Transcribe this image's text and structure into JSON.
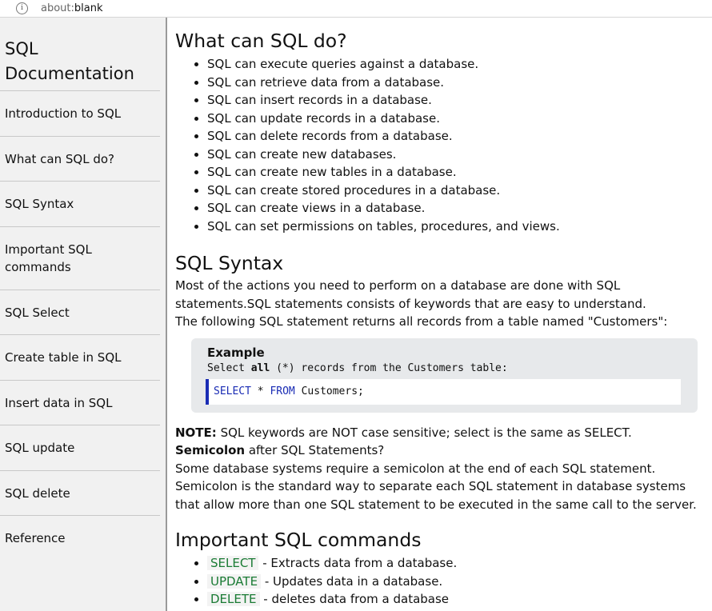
{
  "browser": {
    "url_scheme": "about:",
    "url_rest": "blank"
  },
  "sidebar": {
    "title_line1": "SQL",
    "title_line2": "Documentation",
    "items": [
      {
        "label": "Introduction to SQL"
      },
      {
        "label": "What can SQL do?"
      },
      {
        "label": "SQL Syntax"
      },
      {
        "label_line1": "Important SQL",
        "label_line2": "commands"
      },
      {
        "label": "SQL Select"
      },
      {
        "label": "Create table in SQL"
      },
      {
        "label": "Insert data in SQL"
      },
      {
        "label": "SQL update"
      },
      {
        "label": "SQL delete"
      },
      {
        "label": "Reference"
      }
    ]
  },
  "section_can_do": {
    "heading": "What can SQL do?",
    "items": [
      "SQL can execute queries against a database.",
      "SQL can retrieve data from a database.",
      "SQL can insert records in a database.",
      "SQL can update records in a database.",
      "SQL can delete records from a database.",
      "SQL can create new databases.",
      "SQL can create new tables in a database.",
      "SQL can create stored procedures in a database.",
      "SQL can create views in a database.",
      "SQL can set permissions on tables, procedures, and views."
    ]
  },
  "section_syntax": {
    "heading": "SQL Syntax",
    "para_line1": "Most of the actions you need to perform on a database are done with SQL",
    "para_line2": "statements.SQL statements consists of keywords that are easy to understand.",
    "para_line3": "The following SQL statement returns all records from a table named \"Customers\":",
    "example": {
      "title": "Example",
      "desc_pre": "Select ",
      "desc_bold": "all",
      "desc_post": " (*) records from the Customers table:",
      "code_kw1": "SELECT",
      "code_mid": " * ",
      "code_kw2": "FROM",
      "code_rest": " Customers;"
    },
    "note_label": "NOTE:",
    "note_text": " SQL keywords are NOT case sensitive; select is the same as SELECT.",
    "semicolon_label": "Semicolon",
    "semicolon_text": " after SQL Statements?",
    "semi_line1": "Some database systems require a semicolon at the end of each SQL statement.",
    "semi_line2": "Semicolon is the standard way to separate each SQL statement in database systems",
    "semi_line3": "that allow more than one SQL statement to be executed in the same call to the server."
  },
  "section_commands": {
    "heading": "Important SQL commands",
    "items": [
      {
        "cmd": "SELECT",
        "desc": " - Extracts data from a database."
      },
      {
        "cmd": "UPDATE",
        "desc": " - Updates data in a database."
      },
      {
        "cmd": "DELETE",
        "desc": " - deletes data from a database"
      }
    ]
  }
}
